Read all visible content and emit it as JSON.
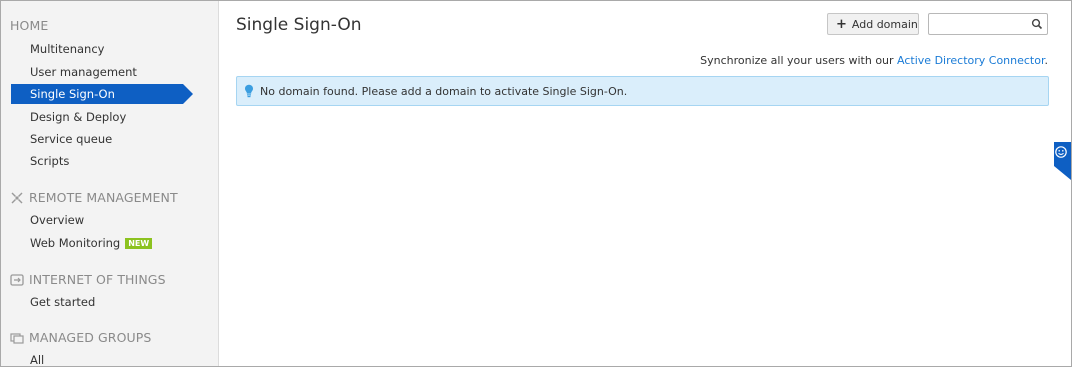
{
  "sidebar": {
    "home": {
      "header": "HOME",
      "items": [
        "Multitenancy",
        "User management",
        "Single Sign-On",
        "Design & Deploy",
        "Service queue",
        "Scripts"
      ]
    },
    "remote": {
      "header": "REMOTE MANAGEMENT",
      "icon": "remote-management-icon",
      "items": [
        "Overview",
        "Web Monitoring"
      ],
      "badge": "NEW"
    },
    "iot": {
      "header": "INTERNET OF THINGS",
      "icon": "iot-icon",
      "items": [
        "Get started"
      ]
    },
    "groups": {
      "header": "MANAGED GROUPS",
      "icon": "managed-groups-icon",
      "items": [
        "All"
      ]
    }
  },
  "main": {
    "title": "Single Sign-On",
    "add_domain_label": "Add domain",
    "search_value": "",
    "sync_text": "Synchronize all your users with our ",
    "sync_link": "Active Directory Connector",
    "sync_end": ".",
    "alert_text": "No domain found. Please add a domain to activate Single Sign-On."
  },
  "colors": {
    "active_nav": "#0e5fc3",
    "link": "#1a7bd6",
    "alert_bg": "#daeefb",
    "badge": "#8cc21f"
  }
}
